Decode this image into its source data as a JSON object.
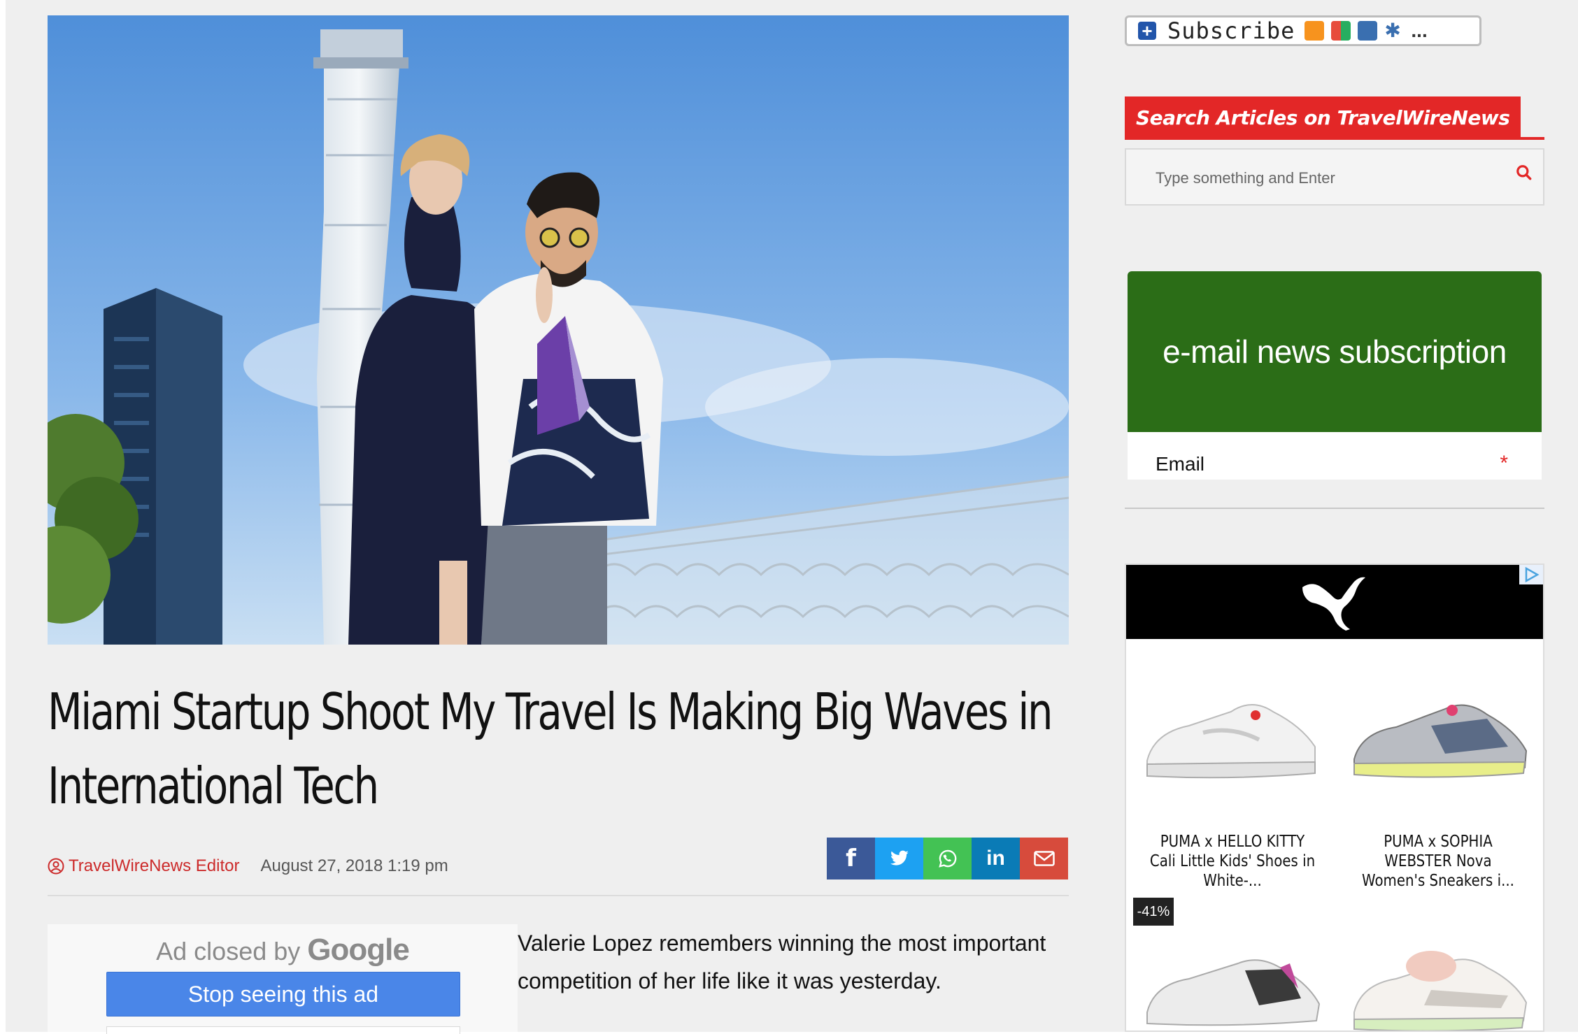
{
  "article": {
    "title": "Miami Startup Shoot My Travel Is Making Big Waves in International Tech",
    "author": "TravelWireNews Editor",
    "date": "August 27, 2018 1:19 pm",
    "body": "Valerie Lopez remembers winning the most important competition of her life like it was yesterday."
  },
  "share": {
    "facebook": "f",
    "twitter": "twitter-icon",
    "whatsapp": "whatsapp-icon",
    "linkedin": "in",
    "email": "email-icon"
  },
  "ad_closed": {
    "text": "Ad closed by",
    "brand": "Google",
    "button": "Stop seeing this ad"
  },
  "sidebar": {
    "subscribe_label": "Subscribe",
    "subscribe_more": "...",
    "search_header": "Search Articles on TravelWireNews",
    "search_placeholder": "Type something and Enter",
    "email_widget_title": "e-mail news subscription",
    "email_label": "Email",
    "email_required": "*"
  },
  "puma_ad": {
    "products": [
      {
        "name": "PUMA x HELLO KITTY Cali Little Kids' Shoes in White-..."
      },
      {
        "name": "PUMA x SOPHIA WEBSTER Nova Women's Sneakers i..."
      }
    ],
    "discount_badge": "-41%"
  },
  "colors": {
    "accent_red": "#e32727",
    "email_green": "#2b6d17",
    "facebook": "#3b5998",
    "twitter": "#1da1f2",
    "whatsapp": "#43c254",
    "linkedin": "#0a7bb6",
    "email": "#d74b3c",
    "google_blue": "#4a86e8"
  }
}
